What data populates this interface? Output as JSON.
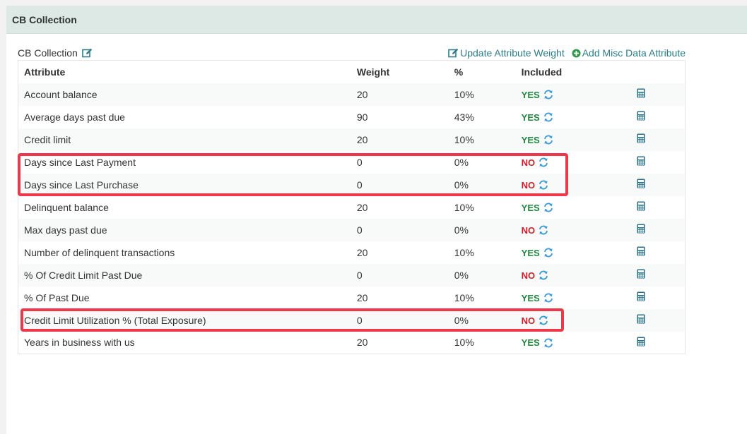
{
  "panel": {
    "title": "CB Collection"
  },
  "section": {
    "title": "CB Collection",
    "edit_icon": "edit-icon",
    "actions": [
      {
        "label": "Update Attribute Weight",
        "icon": "edit-icon"
      },
      {
        "label": "Add Misc Data Attribute",
        "icon": "plus-circle-icon"
      }
    ]
  },
  "table": {
    "headers": [
      "Attribute",
      "Weight",
      "%",
      "Included",
      ""
    ],
    "rows": [
      {
        "attribute": "Account balance",
        "weight": "20",
        "pct": "10%",
        "included": "YES"
      },
      {
        "attribute": "Average days past due",
        "weight": "90",
        "pct": "43%",
        "included": "YES"
      },
      {
        "attribute": "Credit limit",
        "weight": "20",
        "pct": "10%",
        "included": "YES"
      },
      {
        "attribute": "Days since Last Payment",
        "weight": "0",
        "pct": "0%",
        "included": "NO"
      },
      {
        "attribute": "Days since Last Purchase",
        "weight": "0",
        "pct": "0%",
        "included": "NO"
      },
      {
        "attribute": "Delinquent balance",
        "weight": "20",
        "pct": "10%",
        "included": "YES"
      },
      {
        "attribute": "Max days past due",
        "weight": "0",
        "pct": "0%",
        "included": "NO"
      },
      {
        "attribute": "Number of delinquent transactions",
        "weight": "20",
        "pct": "10%",
        "included": "YES"
      },
      {
        "attribute": "% Of Credit Limit Past Due",
        "weight": "0",
        "pct": "0%",
        "included": "NO"
      },
      {
        "attribute": "% Of Past Due",
        "weight": "20",
        "pct": "10%",
        "included": "YES"
      },
      {
        "attribute": "Credit Limit Utilization % (Total Exposure)",
        "weight": "0",
        "pct": "0%",
        "included": "NO"
      },
      {
        "attribute": "Years in business with us",
        "weight": "20",
        "pct": "10%",
        "included": "YES"
      }
    ]
  },
  "colors": {
    "header_bg": "#dde9e5",
    "link": "#2a7d88",
    "yes": "#1f8a3b",
    "no": "#d81b2b",
    "refresh": "#3a9bd8",
    "calculator": "#2a6f8a",
    "highlight": "#f03649"
  }
}
